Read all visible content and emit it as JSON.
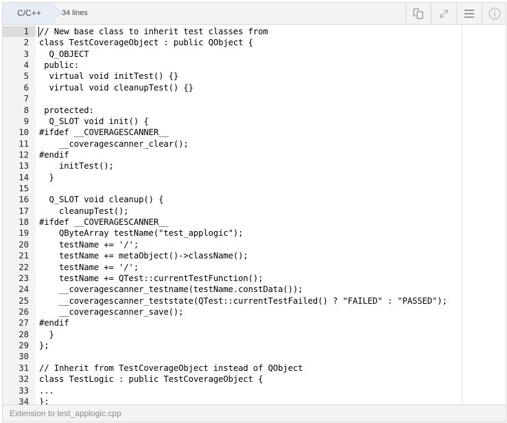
{
  "toolbar": {
    "language": "C/C++",
    "line_count": "34 lines",
    "buttons": [
      "copy",
      "expand",
      "menu",
      "info"
    ]
  },
  "code": {
    "lines": [
      "// New base class to inherit test classes from",
      "class TestCoverageObject : public QObject {",
      "  Q_OBJECT",
      " public:",
      "  virtual void initTest() {}",
      "  virtual void cleanupTest() {}",
      "",
      " protected:",
      "  Q_SLOT void init() {",
      "#ifdef __COVERAGESCANNER__",
      "    __coveragescanner_clear();",
      "#endif",
      "    initTest();",
      "  }",
      "",
      "  Q_SLOT void cleanup() {",
      "    cleanupTest();",
      "#ifdef __COVERAGESCANNER__",
      "    QByteArray testName(\"test_applogic\");",
      "    testName += '/';",
      "    testName += metaObject()->className();",
      "    testName += '/';",
      "    testName += QTest::currentTestFunction();",
      "    __coveragescanner_testname(testName.constData());",
      "    __coveragescanner_teststate(QTest::currentTestFailed() ? \"FAILED\" : \"PASSED\");",
      "    __coveragescanner_save();",
      "#endif",
      "  }",
      "};",
      "",
      "// Inherit from TestCoverageObject instead of QObject",
      "class TestLogic : public TestCoverageObject {",
      "...",
      "};"
    ]
  },
  "footer": {
    "caption": "Extension to test_applogic.cpp"
  }
}
